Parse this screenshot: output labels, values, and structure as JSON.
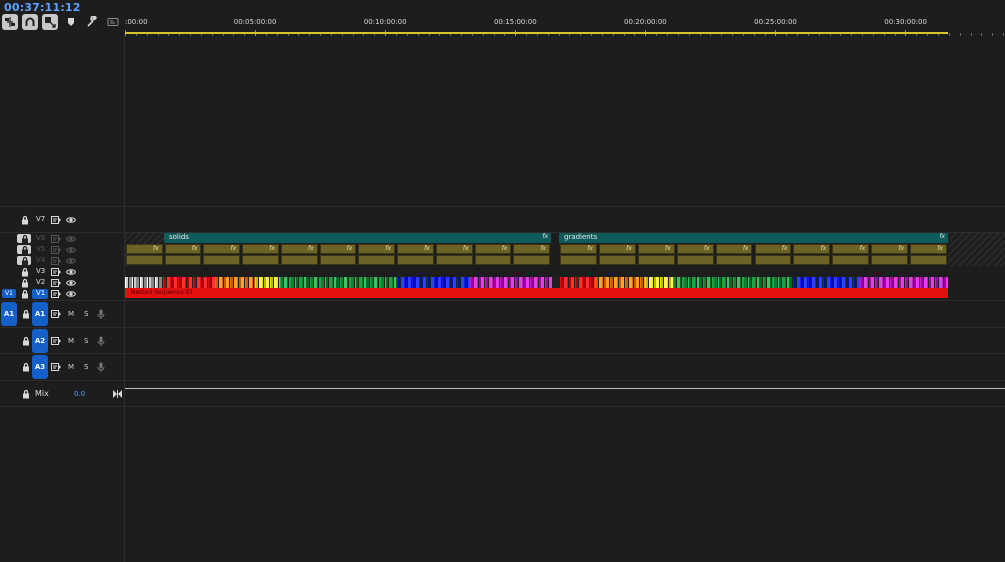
{
  "timecode": "00:37:11:12",
  "toolbar": {
    "tools": [
      {
        "name": "insert-overwrite-sequence-icon",
        "active": true
      },
      {
        "name": "snap-icon",
        "active": true
      },
      {
        "name": "linked-selection-icon",
        "active": true
      },
      {
        "name": "add-marker-icon",
        "active": false
      },
      {
        "name": "wrench-icon",
        "active": false
      },
      {
        "name": "captions-icon",
        "active": false
      }
    ]
  },
  "ruler": {
    "labels": [
      ":00:00",
      "00:05:00:00",
      "00:10:00:00",
      "00:15:00:00",
      "00:20:00:00",
      "00:25:00:00",
      "00:30:00:00"
    ]
  },
  "video_tracks": [
    {
      "name": "V7",
      "locked": false,
      "enabled": true
    },
    {
      "name": "V6",
      "locked": true,
      "enabled": false
    },
    {
      "name": "V5",
      "locked": true,
      "enabled": false
    },
    {
      "name": "V4",
      "locked": true,
      "enabled": false
    },
    {
      "name": "V3",
      "locked": false,
      "enabled": true
    },
    {
      "name": "V2",
      "locked": false,
      "enabled": true
    },
    {
      "name": "V1",
      "locked": false,
      "enabled": true,
      "source": "V1"
    }
  ],
  "audio_tracks": [
    {
      "name": "A1",
      "source": "A1",
      "m": "M",
      "s": "S"
    },
    {
      "name": "A2",
      "m": "M",
      "s": "S"
    },
    {
      "name": "A3",
      "m": "M",
      "s": "S"
    }
  ],
  "mix": {
    "label": "Mix",
    "value": "0.0"
  },
  "clips": {
    "v6": [
      {
        "label": "solids",
        "fx": "fx"
      },
      {
        "label": "gradients",
        "fx": "fx"
      }
    ],
    "fx_label": "fx",
    "nested": "Nested Sequence 01"
  },
  "colors": {
    "accent": "#1560c8",
    "timecode": "#5ea3ff",
    "workarea": "#d5c526",
    "teal_clip": "#0f5a5a",
    "olive_clip": "#6c6226",
    "nested_clip": "#e21010"
  }
}
